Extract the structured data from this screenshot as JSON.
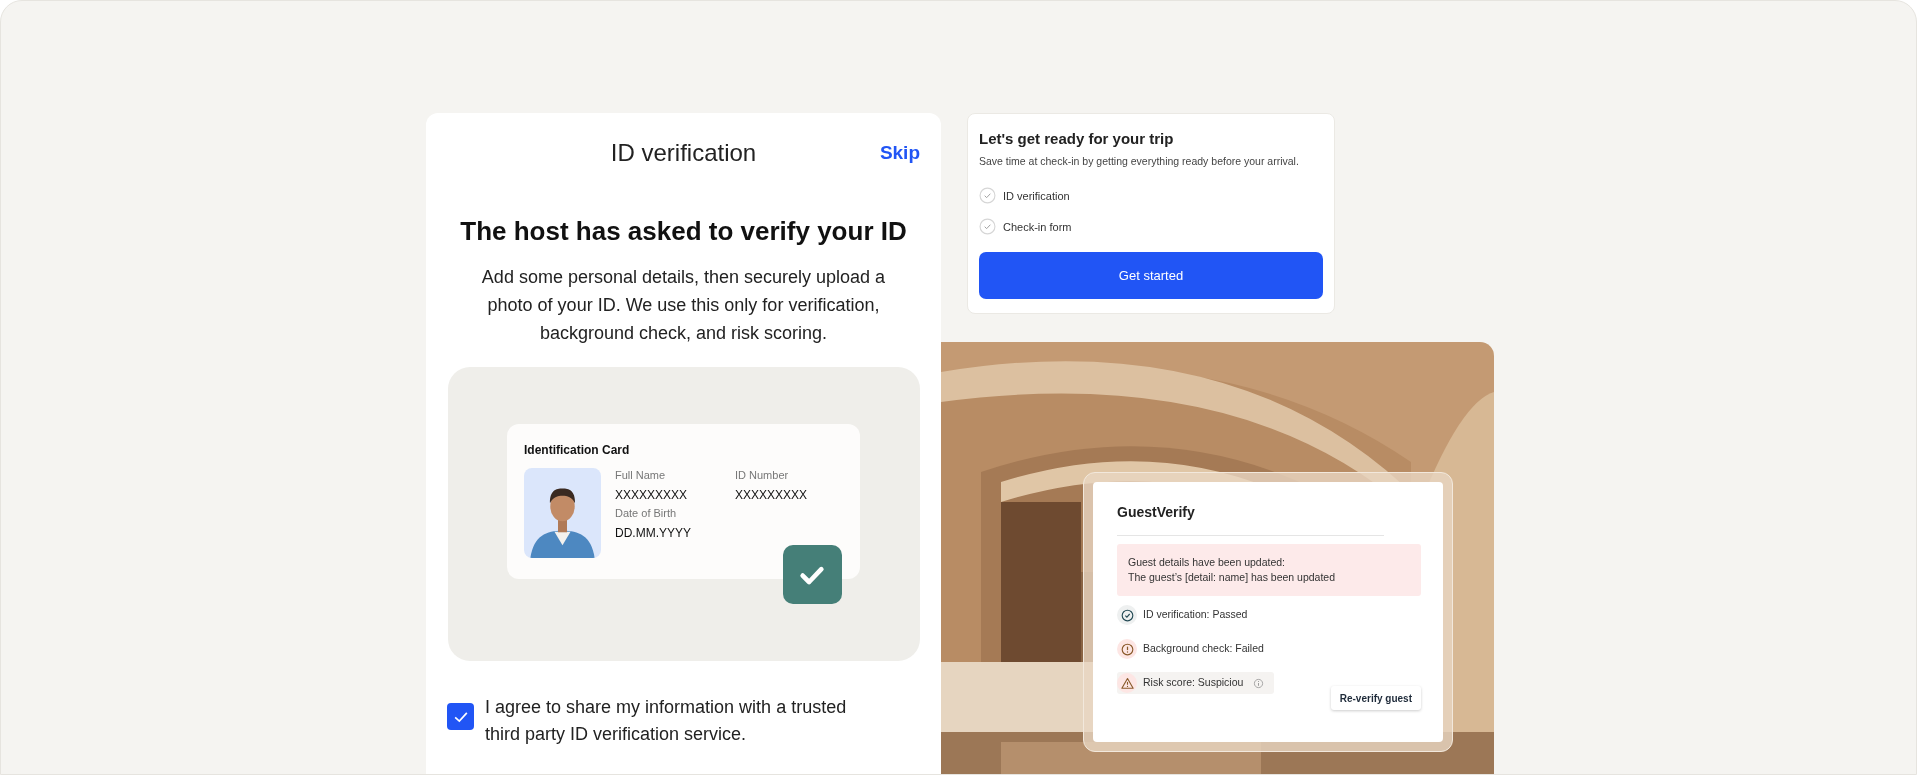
{
  "verify_panel": {
    "title": "ID verification",
    "skip": "Skip",
    "heading": "The host has asked to verify your ID",
    "description": "Add some personal details, then securely upload a photo of your ID. We use this only for verification, background check, and risk scoring.",
    "id_card": {
      "title": "Identification Card",
      "verified": true,
      "fields": [
        {
          "label": "Full Name",
          "value": "XXXXXXXXX"
        },
        {
          "label": "ID Number",
          "value": "XXXXXXXXX"
        },
        {
          "label": "Date of Birth",
          "value": "DD.MM.YYYY"
        }
      ]
    },
    "consent": {
      "checked": true,
      "text": "I agree to share my information with a trusted third party ID verification service."
    }
  },
  "trip_card": {
    "title": "Let's get ready for your trip",
    "subtitle": "Save time at check-in by getting everything ready before your arrival.",
    "items": [
      {
        "label": "ID verification",
        "done": false
      },
      {
        "label": "Check-in form",
        "done": false
      }
    ],
    "button": "Get started"
  },
  "guest_verify": {
    "title": "GuestVerify",
    "alert": [
      "Guest details have been updated:",
      "The guest’s [detail: name] has been updated"
    ],
    "statuses": [
      {
        "kind": "passed",
        "label": "ID verification: Passed",
        "has_info": false
      },
      {
        "kind": "failed",
        "label": "Background check: Failed",
        "has_info": false
      },
      {
        "kind": "suspicious",
        "label": "Risk score: Suspiciou",
        "has_info": true
      }
    ],
    "button": "Re-verify guest"
  }
}
